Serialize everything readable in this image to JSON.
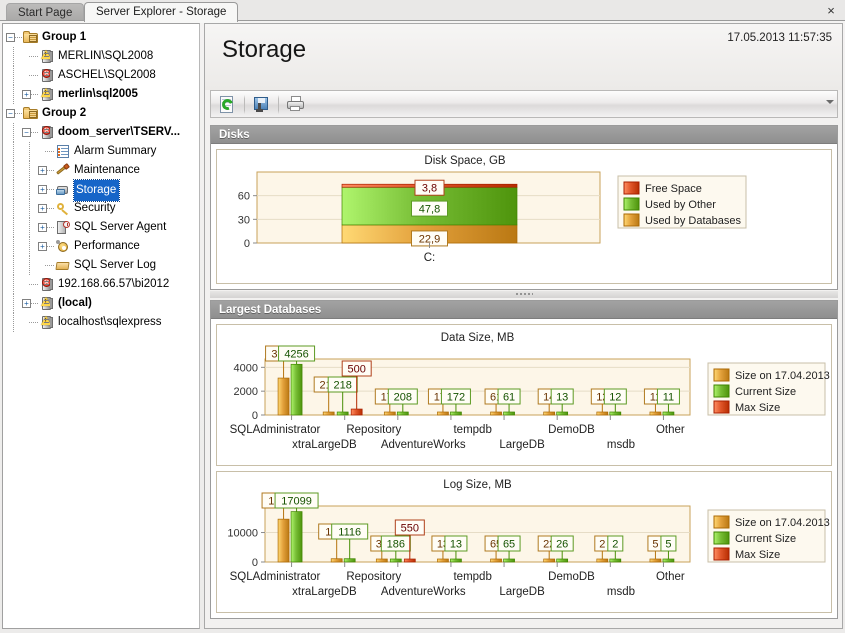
{
  "window": {
    "close_label": "×",
    "tabs": [
      {
        "label": "Start Page",
        "active": false
      },
      {
        "label": "Server Explorer - Storage",
        "active": true
      }
    ]
  },
  "tree": {
    "nodes": [
      {
        "label": "Group 1",
        "icon": "folder-icon",
        "depth": 0,
        "bold": true,
        "expander": "minus",
        "badge": "none"
      },
      {
        "label": "MERLIN\\SQL2008",
        "icon": "server-icon",
        "depth": 1,
        "bold": false,
        "expander": "none",
        "badge": "warning"
      },
      {
        "label": "ASCHEL\\SQL2008",
        "icon": "server-icon",
        "depth": 1,
        "bold": false,
        "expander": "none",
        "badge": "error"
      },
      {
        "label": "merlin\\sql2005",
        "icon": "server-icon",
        "depth": 1,
        "bold": true,
        "expander": "plus",
        "badge": "warning"
      },
      {
        "label": "Group 2",
        "icon": "folder-icon",
        "depth": 0,
        "bold": true,
        "expander": "minus",
        "badge": "none"
      },
      {
        "label": "doom_server\\TSERV...",
        "icon": "server-icon",
        "depth": 1,
        "bold": true,
        "expander": "minus",
        "badge": "error"
      },
      {
        "label": "Alarm Summary",
        "icon": "alarm-summary-icon",
        "depth": 2,
        "bold": false,
        "expander": "none",
        "badge": "none"
      },
      {
        "label": "Maintenance",
        "icon": "maintenance-icon",
        "depth": 2,
        "bold": false,
        "expander": "plus",
        "badge": "none"
      },
      {
        "label": "Storage",
        "icon": "storage-icon",
        "depth": 2,
        "bold": false,
        "expander": "plus",
        "badge": "none",
        "selected": true
      },
      {
        "label": "Security",
        "icon": "security-key-icon",
        "depth": 2,
        "bold": false,
        "expander": "plus",
        "badge": "none"
      },
      {
        "label": "SQL Server Agent",
        "icon": "sql-agent-icon",
        "depth": 2,
        "bold": false,
        "expander": "plus",
        "badge": "none"
      },
      {
        "label": "Performance",
        "icon": "performance-gear-icon",
        "depth": 2,
        "bold": false,
        "expander": "plus",
        "badge": "none"
      },
      {
        "label": "SQL Server Log",
        "icon": "log-icon",
        "depth": 2,
        "bold": false,
        "expander": "none",
        "badge": "none"
      },
      {
        "label": "192.168.66.57\\bi2012",
        "icon": "server-icon",
        "depth": 1,
        "bold": false,
        "expander": "none",
        "badge": "error"
      },
      {
        "label": "(local)",
        "icon": "server-icon",
        "depth": 1,
        "bold": true,
        "expander": "plus",
        "badge": "warning"
      },
      {
        "label": "localhost\\sqlexpress",
        "icon": "server-icon",
        "depth": 1,
        "bold": false,
        "expander": "none",
        "badge": "warning"
      }
    ]
  },
  "page": {
    "title": "Storage",
    "timestamp": "17.05.2013 11:57:35"
  },
  "toolbar": {
    "buttons": [
      {
        "name": "refresh-button",
        "icon": "refresh-icon"
      },
      {
        "name": "export-button",
        "icon": "export-disk-icon"
      },
      {
        "name": "print-button",
        "icon": "printer-icon"
      }
    ],
    "overflow_icon": "chevron-down-icon"
  },
  "panels": {
    "disks": {
      "title": "Disks"
    },
    "largest_databases": {
      "title": "Largest Databases"
    }
  },
  "colors": {
    "orange": "#e3a13c",
    "green": "#77bd35",
    "red": "#e0562a",
    "plot_bg": "#fdf6e8",
    "plot_border": "#c8a25a",
    "grid": "#e6dcc6"
  },
  "chart_data": [
    {
      "id": "disk-space-chart",
      "type": "bar",
      "stacked": true,
      "title": "Disk Space, GB",
      "xlabel": "",
      "ylabel": "",
      "categories": [
        "C:"
      ],
      "ylim": [
        0,
        90
      ],
      "yticks": [
        0,
        30,
        60
      ],
      "ytick_labels": [
        "0",
        "30",
        "60"
      ],
      "grid": true,
      "legend_position": "right",
      "series": [
        {
          "name": "Free Space",
          "color": "#e0562a",
          "values": [
            3.8
          ],
          "labels": [
            "3,8"
          ]
        },
        {
          "name": "Used by Other",
          "color": "#77bd35",
          "values": [
            47.8
          ],
          "labels": [
            "47,8"
          ]
        },
        {
          "name": "Used by Databases",
          "color": "#e3a13c",
          "values": [
            22.9
          ],
          "labels": [
            "22,9"
          ]
        }
      ]
    },
    {
      "id": "data-size-chart",
      "type": "bar",
      "stacked": false,
      "title": "Data Size, MB",
      "xlabel": "",
      "ylabel": "",
      "categories": [
        "SQLAdministrator",
        "xtraLargeDB",
        "Repository",
        "AdventureWorks",
        "tempdb",
        "LargeDB",
        "DemoDB",
        "msdb",
        "Other"
      ],
      "ylim": [
        0,
        4700
      ],
      "yticks": [
        0,
        2000,
        4000
      ],
      "ytick_labels": [
        "0",
        "2000",
        "4000"
      ],
      "grid": true,
      "legend_position": "right",
      "series": [
        {
          "name": "Size on 17.04.2013",
          "color": "#e3a13c",
          "values": [
            3101,
            218,
            176,
            172,
            61,
            14,
            12,
            11
          ],
          "labels": [
            "3101",
            "218",
            "176",
            "172",
            "61",
            "14",
            "12",
            "11"
          ]
        },
        {
          "name": "Current Size",
          "color": "#77bd35",
          "values": [
            4256,
            218,
            208,
            172,
            61,
            13,
            12,
            11
          ],
          "labels": [
            "4256",
            "218",
            "208",
            "172",
            "61",
            "13",
            "12",
            "11"
          ]
        },
        {
          "name": "Max Size",
          "color": "#e0562a",
          "values": [
            null,
            500,
            null,
            null,
            null,
            null,
            null,
            null
          ],
          "labels": [
            null,
            "500",
            null,
            null,
            null,
            null,
            null,
            null
          ]
        }
      ]
    },
    {
      "id": "log-size-chart",
      "type": "bar",
      "stacked": false,
      "title": "Log Size, MB",
      "xlabel": "",
      "ylabel": "",
      "categories": [
        "SQLAdministrator",
        "xtraLargeDB",
        "Repository",
        "AdventureWorks",
        "tempdb",
        "LargeDB",
        "DemoDB",
        "msdb",
        "Other"
      ],
      "ylim": [
        0,
        19000
      ],
      "yticks": [
        0,
        10000
      ],
      "ytick_labels": [
        "0",
        "10000"
      ],
      "grid": true,
      "legend_position": "right",
      "series": [
        {
          "name": "Size on 17.04.2013",
          "color": "#e3a13c",
          "values": [
            14538,
            1116,
            30,
            13,
            65,
            22,
            2,
            5
          ],
          "labels": [
            "14538",
            "1116",
            "30",
            "13",
            "65",
            "22",
            "2",
            "5"
          ]
        },
        {
          "name": "Current Size",
          "color": "#77bd35",
          "values": [
            17099,
            1116,
            186,
            13,
            65,
            26,
            2,
            5
          ],
          "labels": [
            "17099",
            "1116",
            "186",
            "13",
            "65",
            "26",
            "2",
            "5"
          ]
        },
        {
          "name": "Max Size",
          "color": "#e0562a",
          "values": [
            null,
            null,
            550,
            null,
            null,
            null,
            null,
            null
          ],
          "labels": [
            null,
            null,
            "550",
            null,
            null,
            null,
            null,
            null
          ]
        }
      ]
    }
  ]
}
